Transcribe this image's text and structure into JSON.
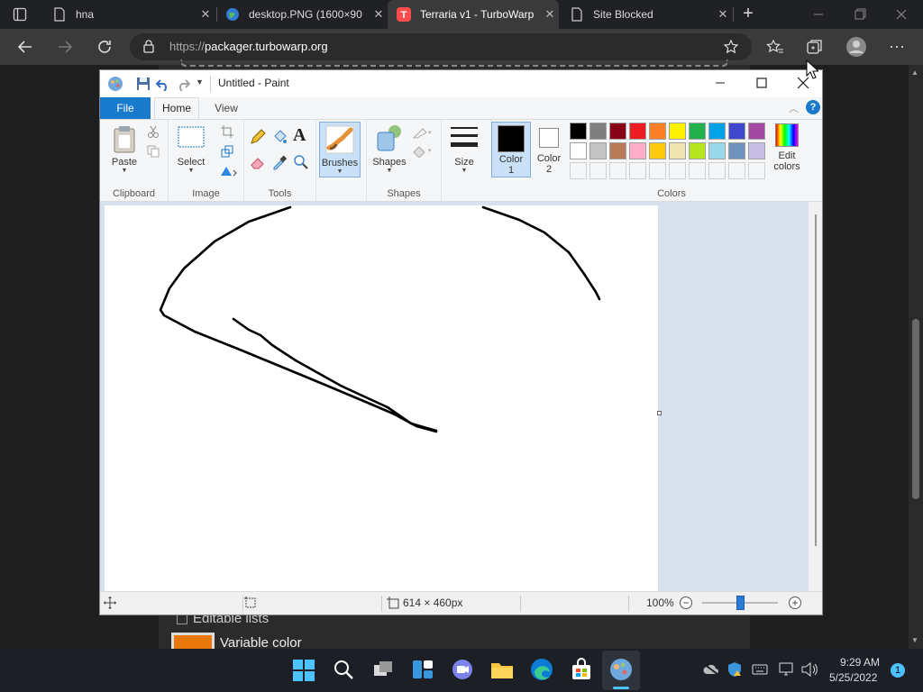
{
  "browser": {
    "tabs": [
      {
        "label": "hna",
        "icon": "page-icon"
      },
      {
        "label": "desktop.PNG (1600×90",
        "icon": "globe-icon"
      },
      {
        "label": "Terraria v1 - TurboWarp",
        "icon": "turbowarp-icon"
      },
      {
        "label": "Site Blocked",
        "icon": "page-icon"
      }
    ],
    "url_prefix": "https://",
    "url_host": "packager.turbowarp.org"
  },
  "paint": {
    "title": "Untitled - Paint",
    "menu": {
      "file": "File",
      "home": "Home",
      "view": "View"
    },
    "groups": {
      "clipboard": "Clipboard",
      "image": "Image",
      "tools": "Tools",
      "shapes": "Shapes",
      "colors": "Colors"
    },
    "buttons": {
      "paste": "Paste",
      "select": "Select",
      "brushes": "Brushes",
      "shapes": "Shapes",
      "size": "Size",
      "color1_a": "Color",
      "color1_b": "1",
      "color2_a": "Color",
      "color2_b": "2",
      "edit_colors_a": "Edit",
      "edit_colors_b": "colors"
    },
    "palette_row1": [
      "#000000",
      "#7f7f7f",
      "#880015",
      "#ed1c24",
      "#ff7f27",
      "#fff200",
      "#22b14c",
      "#00a2e8",
      "#3f48cc",
      "#a349a4"
    ],
    "palette_row2": [
      "#ffffff",
      "#c3c3c3",
      "#b97a57",
      "#ffaec9",
      "#ffc90e",
      "#efe4b0",
      "#b5e61d",
      "#99d9ea",
      "#7092be",
      "#c8bfe7"
    ],
    "color1": "#000000",
    "color2": "#ffffff",
    "status": {
      "size": "614 × 460px",
      "zoom": "100%"
    }
  },
  "page": {
    "editable_lists": "Editable lists",
    "variable_color": "Variable color",
    "variable_color_swatch": "#e8780c"
  },
  "taskbar": {
    "time": "9:29 AM",
    "date": "5/25/2022",
    "notification_count": "1"
  }
}
